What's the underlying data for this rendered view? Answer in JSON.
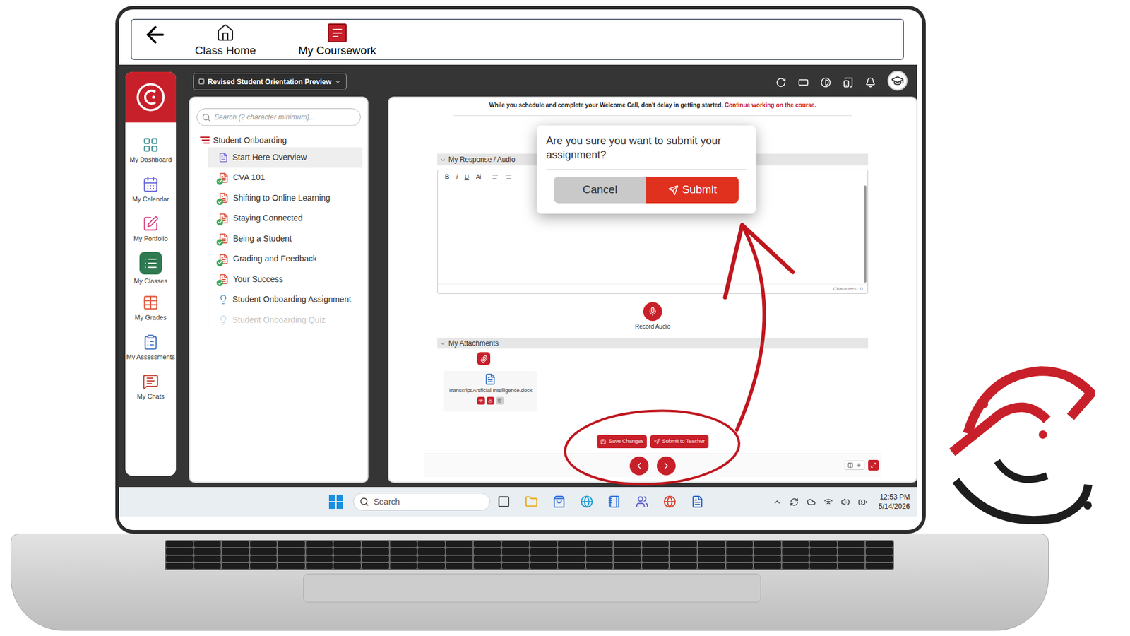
{
  "top_nav": {
    "items": [
      {
        "label": "Class Home",
        "selected": false
      },
      {
        "label": "My Coursework",
        "selected": true
      }
    ]
  },
  "course_select": {
    "value": "Revised Student Orientation Preview"
  },
  "sidebar": {
    "items": [
      {
        "label": "My Dashboard",
        "selected": false,
        "color": "#3b8a8f"
      },
      {
        "label": "My Calendar",
        "selected": false,
        "color": "#5b5bd6"
      },
      {
        "label": "My Portfolio",
        "selected": false,
        "color": "#d63b7a"
      },
      {
        "label": "My Classes",
        "selected": true,
        "color": "#2f7a50"
      },
      {
        "label": "My Grades",
        "selected": false,
        "color": "#e0533a"
      },
      {
        "label": "My Assessments",
        "selected": false,
        "color": "#3a6ec2"
      },
      {
        "label": "My Chats",
        "selected": false,
        "color": "#c0392b"
      }
    ]
  },
  "tree": {
    "search_placeholder": "Search (2 character minimum)...",
    "root": "Student Onboarding",
    "items": [
      {
        "label": "Start Here Overview",
        "kind": "page",
        "selected": true,
        "completed": false,
        "disabled": false
      },
      {
        "label": "CVA 101",
        "kind": "lesson",
        "selected": false,
        "completed": true,
        "disabled": false
      },
      {
        "label": "Shifting to Online Learning",
        "kind": "lesson",
        "selected": false,
        "completed": true,
        "disabled": false
      },
      {
        "label": "Staying Connected",
        "kind": "lesson",
        "selected": false,
        "completed": true,
        "disabled": false
      },
      {
        "label": "Being a Student",
        "kind": "lesson",
        "selected": false,
        "completed": true,
        "disabled": false
      },
      {
        "label": "Grading and Feedback",
        "kind": "lesson",
        "selected": false,
        "completed": true,
        "disabled": false
      },
      {
        "label": "Your Success",
        "kind": "lesson",
        "selected": false,
        "completed": true,
        "disabled": false
      },
      {
        "label": "Student Onboarding Assignment",
        "kind": "assignment",
        "selected": false,
        "completed": false,
        "disabled": false
      },
      {
        "label": "Student Onboarding Quiz",
        "kind": "assignment",
        "selected": false,
        "completed": false,
        "disabled": true
      }
    ]
  },
  "notice": {
    "text": "While you schedule and complete your Welcome Call, don't delay in getting started.",
    "link": "Continue working on the course."
  },
  "response": {
    "title": "My Response / Audio",
    "toolbar": [
      "B",
      "i",
      "U",
      "Ai"
    ],
    "characters": "Characters : 0",
    "record": "Record Audio"
  },
  "attachments": {
    "title": "My Attachments",
    "files": [
      "Transcript Artificial Intelligence.docx"
    ]
  },
  "actions": [
    "Save Changes",
    "Submit to Teacher"
  ],
  "dialog": {
    "message": "Are you sure you want to submit your assignment?",
    "buttons": [
      {
        "label": "Cancel",
        "kind": "secondary"
      },
      {
        "label": "Submit",
        "kind": "primary"
      }
    ]
  },
  "taskbar": {
    "search": "Search",
    "time": "12:53 PM",
    "date": "5/14/2026"
  }
}
